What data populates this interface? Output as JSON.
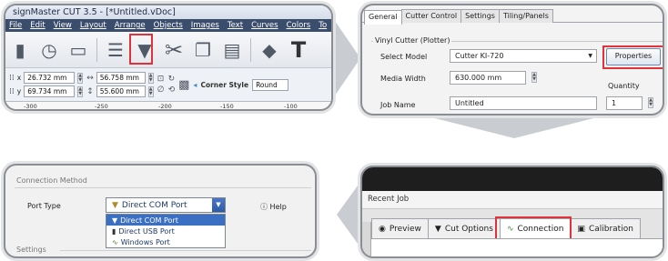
{
  "toolbar_panel": {
    "title": "signMaster CUT 3.5 - [*Untitled.vDoc]",
    "menu": [
      "File",
      "Edit",
      "View",
      "Layout",
      "Arrange",
      "Objects",
      "Images",
      "Text",
      "Curves",
      "Colors",
      "To"
    ],
    "x_value": "26.732 mm",
    "y_value": "69.734 mm",
    "width_value": "56.758 mm",
    "height_value": "55.600 mm",
    "corner_style_label": "Corner Style",
    "corner_style_value": "Round",
    "ruler_ticks": [
      "-300",
      "-250",
      "-200",
      "-150",
      "-100"
    ]
  },
  "general_panel": {
    "tabs": [
      "General",
      "Cutter Control",
      "Settings",
      "Tiling/Panels"
    ],
    "group_title": "Vinyl Cutter (Plotter)",
    "select_model_label": "Select Model",
    "select_model_value": "Cutter KI-720",
    "properties_button": "Properties",
    "media_width_label": "Media Width",
    "media_width_value": "630.000 mm",
    "quantity_label": "Quantity",
    "quantity_value": "1",
    "job_name_label": "Job Name",
    "job_name_value": "Untitled"
  },
  "connection_method_panel": {
    "heading": "Connection Method",
    "port_type_label": "Port Type",
    "port_type_value": "Direct COM Port",
    "help_label": "Help",
    "options": [
      "Direct COM Port",
      "Direct USB Port",
      "Windows Port"
    ],
    "settings_label": "Settings"
  },
  "connection_tab_panel": {
    "recent_job": "Recent Job",
    "tabs": [
      "Preview",
      "Cut Options",
      "Connection",
      "Calibration"
    ]
  },
  "colors": {
    "highlight": "#e0323a",
    "menu_bar": "#3a4d6d",
    "selection": "#3a6fc4"
  }
}
